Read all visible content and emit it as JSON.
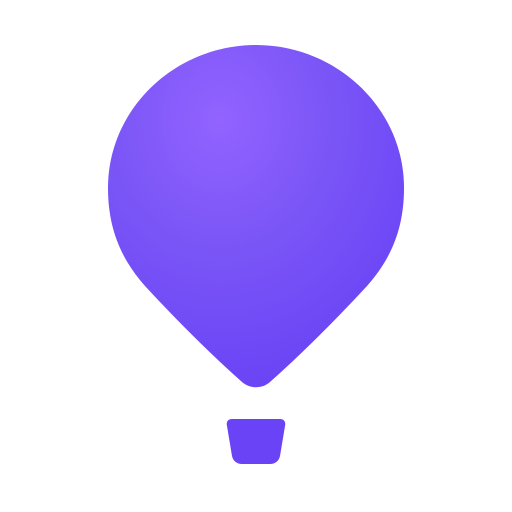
{
  "icon": {
    "name": "hot-air-balloon-icon",
    "background_color": "#FFFFFF",
    "balloon_highlight_color": "#9263FF",
    "balloon_mid_color": "#7A55F6",
    "balloon_base_color": "#6841F5",
    "basket_color": "#6B43F6"
  }
}
